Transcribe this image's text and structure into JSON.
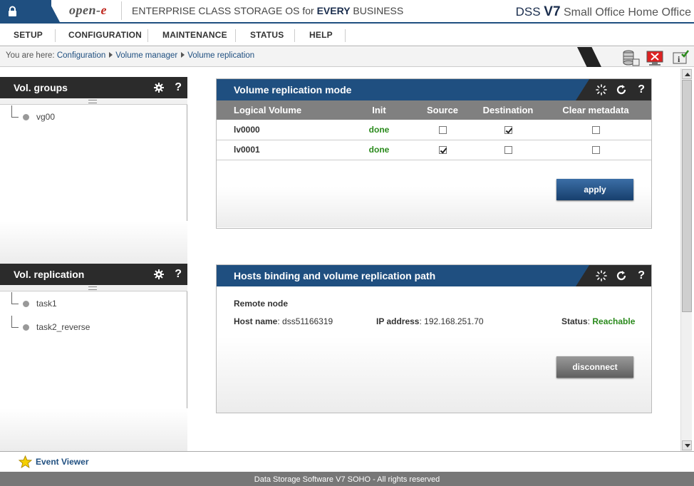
{
  "header": {
    "logo_main": "open-",
    "logo_e": "e",
    "tagline_prefix": "ENTERPRISE CLASS STORAGE OS for ",
    "tagline_bold": "EVERY",
    "tagline_suffix": " BUSINESS",
    "brand_dss": "DSS ",
    "brand_v": "V7",
    "brand_suffix": " Small Office Home Office"
  },
  "nav": {
    "items": [
      "SETUP",
      "CONFIGURATION",
      "MAINTENANCE",
      "STATUS",
      "HELP"
    ]
  },
  "breadcrumb": {
    "prefix": "You are here:",
    "items": [
      "Configuration",
      "Volume manager",
      "Volume replication"
    ]
  },
  "left": {
    "vol_groups": {
      "title": "Vol. groups",
      "help": "?",
      "items": [
        "vg00"
      ]
    },
    "vol_replication": {
      "title": "Vol. replication",
      "help": "?",
      "items": [
        "task1",
        "task2_reverse"
      ]
    }
  },
  "replication_mode": {
    "title": "Volume replication mode",
    "help": "?",
    "columns": [
      "Logical Volume",
      "Init",
      "Source",
      "Destination",
      "Clear metadata"
    ],
    "rows": [
      {
        "volume": "lv0000",
        "init": "done",
        "source": false,
        "destination": true,
        "clear": false
      },
      {
        "volume": "lv0001",
        "init": "done",
        "source": true,
        "destination": false,
        "clear": false
      }
    ],
    "apply_label": "apply"
  },
  "hosts_binding": {
    "title": "Hosts binding and volume replication path",
    "help": "?",
    "remote_node_label": "Remote node",
    "host_name_label": "Host name",
    "host_name_value": "dss51166319",
    "ip_label": "IP address",
    "ip_value": "192.168.251.70",
    "status_label": "Status",
    "status_value": "Reachable",
    "disconnect_label": "disconnect"
  },
  "footer": {
    "event_viewer": "Event Viewer",
    "copyright": "Data Storage Software V7 SOHO - All rights reserved"
  },
  "colors": {
    "primary_blue": "#1f4f80",
    "dark": "#2b2b2b",
    "status_green": "#2a8a1c",
    "accent_red": "#c0281f"
  }
}
